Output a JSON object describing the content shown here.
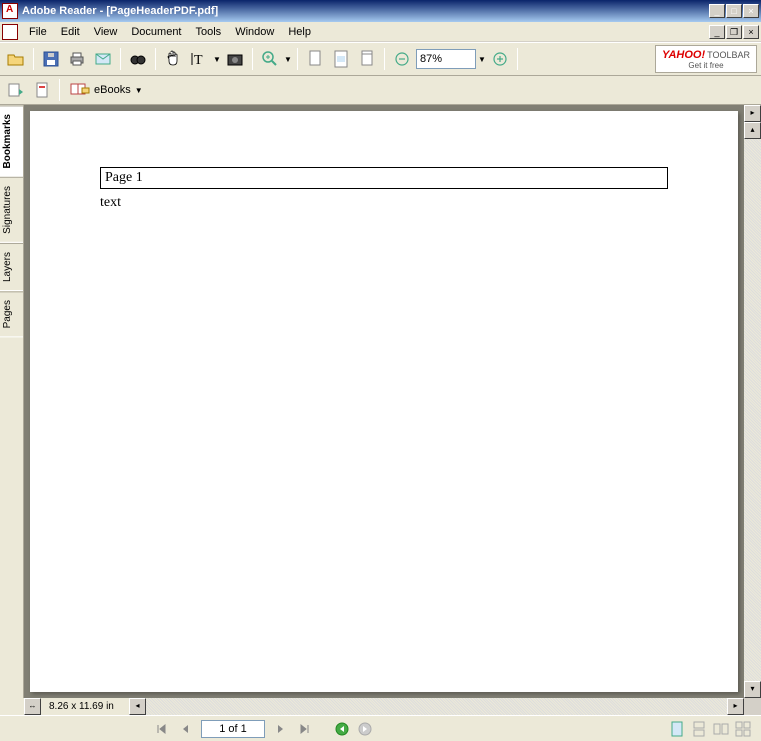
{
  "window": {
    "title": "Adobe Reader - [PageHeaderPDF.pdf]"
  },
  "menu": {
    "items": [
      "File",
      "Edit",
      "View",
      "Document",
      "Tools",
      "Window",
      "Help"
    ]
  },
  "toolbar": {
    "zoom_value": "87%",
    "yahoo_brand": "YAHOO!",
    "yahoo_label": "TOOLBAR",
    "yahoo_sub": "Get it free",
    "ebooks_label": "eBooks"
  },
  "nav_tabs": [
    "Bookmarks",
    "Signatures",
    "Layers",
    "Pages"
  ],
  "document": {
    "header_text": "Page 1",
    "body_text": "text",
    "page_size": "8.26 x 11.69 in"
  },
  "status": {
    "page_display": "1 of 1"
  }
}
